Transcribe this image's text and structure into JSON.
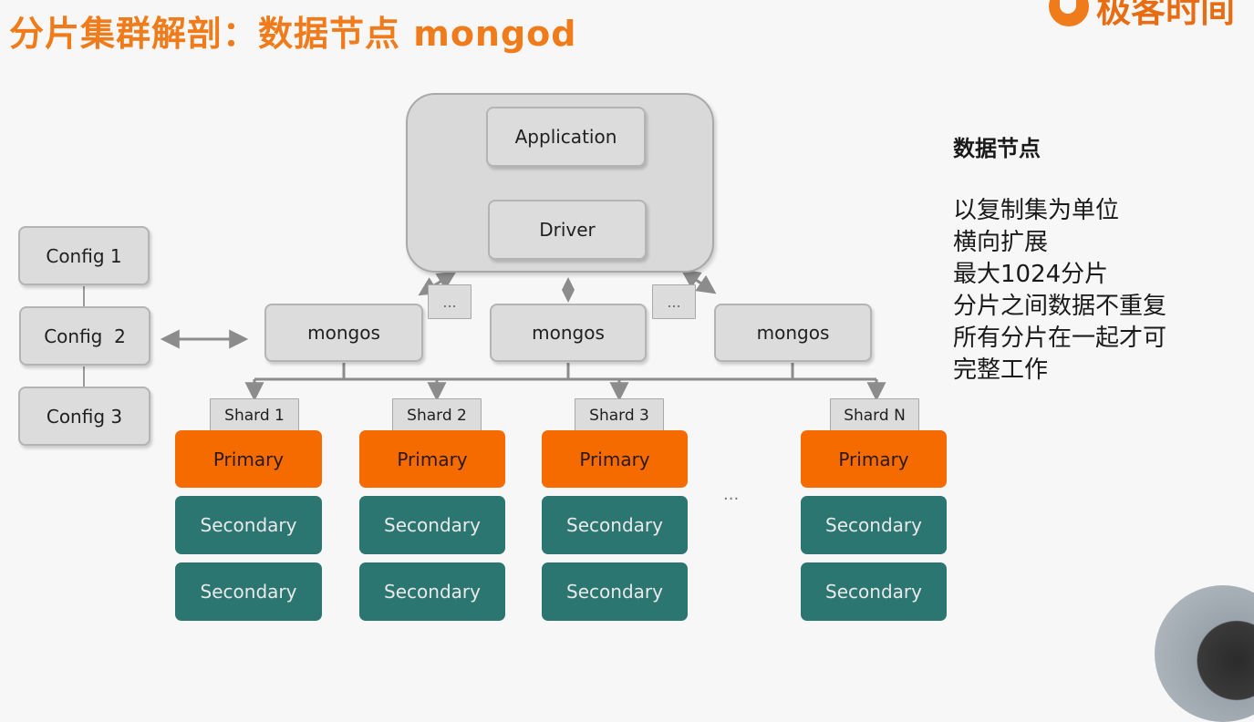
{
  "title": "分片集群解剖：数据节点 mongod",
  "logo": {
    "text": "极客时间",
    "color": "#f07b1a"
  },
  "app": {
    "application": "Application",
    "driver": "Driver"
  },
  "mongos": [
    "mongos",
    "mongos",
    "mongos"
  ],
  "ellipsis": "...",
  "configs": [
    "Config 1",
    "Config  2",
    "Config 3"
  ],
  "shards": [
    {
      "label": "Shard 1",
      "primary": "Primary",
      "secondaries": [
        "Secondary",
        "Secondary"
      ]
    },
    {
      "label": "Shard 2",
      "primary": "Primary",
      "secondaries": [
        "Secondary",
        "Secondary"
      ]
    },
    {
      "label": "Shard 3",
      "primary": "Primary",
      "secondaries": [
        "Secondary",
        "Secondary"
      ]
    },
    {
      "label": "Shard N",
      "primary": "Primary",
      "secondaries": [
        "Secondary",
        "Secondary"
      ]
    }
  ],
  "shard_gap_dots": "...",
  "side": {
    "heading": "数据节点",
    "lines": [
      "以复制集为单位",
      "横向扩展",
      "最大1024分片",
      "分片之间数据不重复",
      "所有分片在一起才可",
      "完整工作"
    ]
  },
  "colors": {
    "primary": "#f56b00",
    "secondary": "#2c7672",
    "title": "#f07b1a",
    "box": "#dcdcdc"
  }
}
